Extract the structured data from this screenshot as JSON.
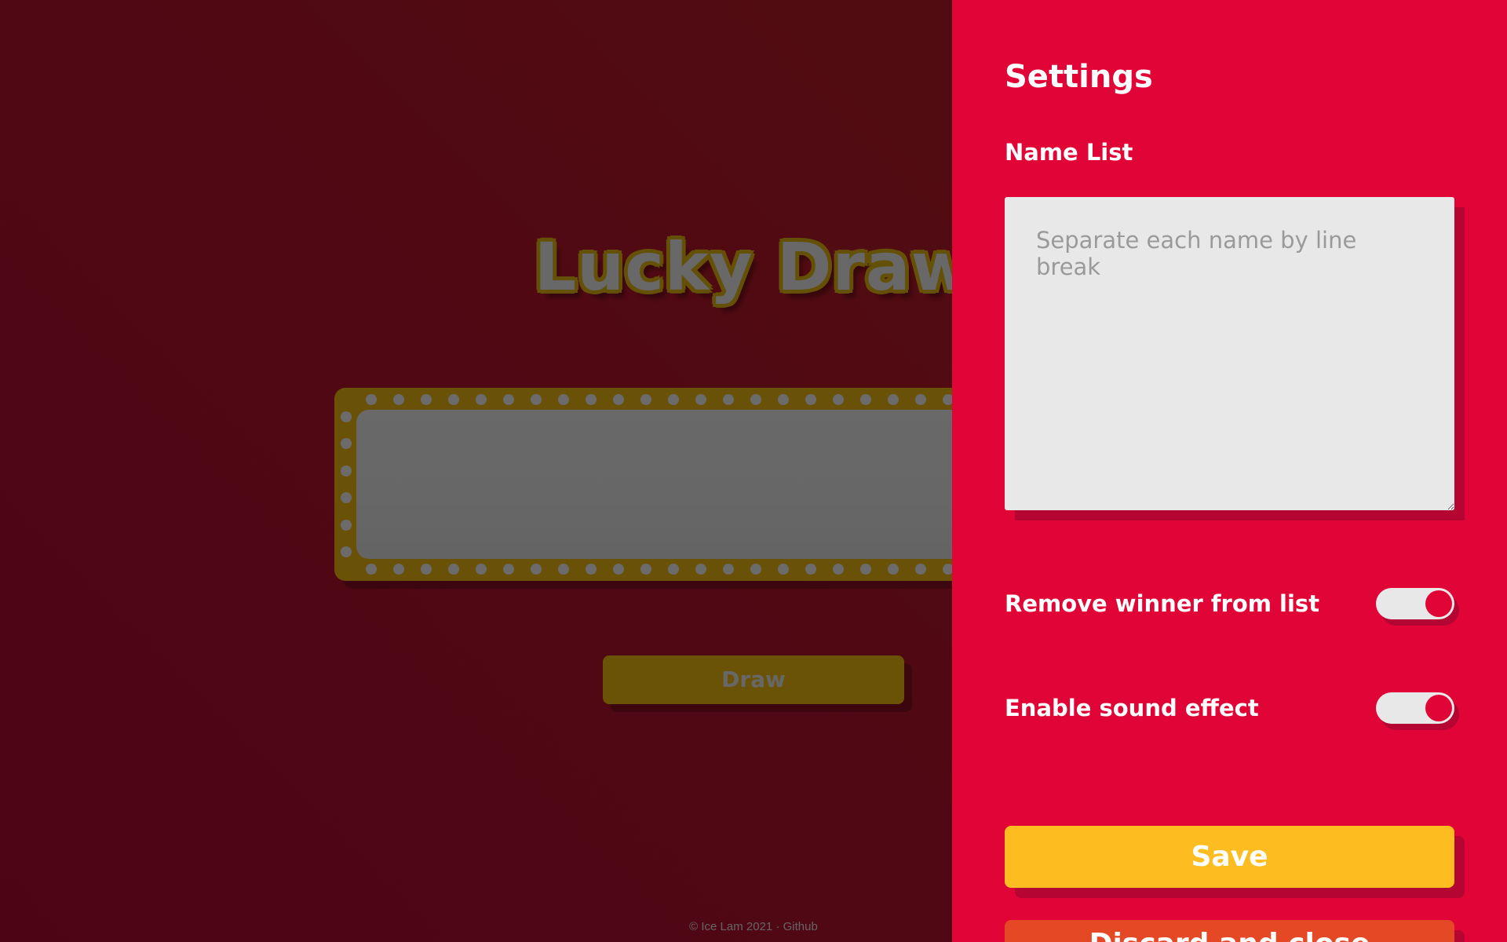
{
  "page": {
    "title": "Lucky Draw",
    "draw_button": "Draw",
    "footer": {
      "copyright": "© Ice Lam 2021",
      "separator": "·",
      "github_link": "Github"
    }
  },
  "settings": {
    "title": "Settings",
    "name_list": {
      "label": "Name List",
      "placeholder": "Separate each name by line break",
      "value": ""
    },
    "remove_winner": {
      "label": "Remove winner from list",
      "enabled": true
    },
    "sound_effect": {
      "label": "Enable sound effect",
      "enabled": true
    },
    "save_button": "Save",
    "discard_button": "Discard and close"
  },
  "colors": {
    "background": "#a01029",
    "drawer": "#e00536",
    "gold": "#d3a20e",
    "save": "#fdbd21",
    "discard": "#e54824",
    "field": "#e8e8e8"
  },
  "icons": {
    "toggle_knob": "circle"
  }
}
